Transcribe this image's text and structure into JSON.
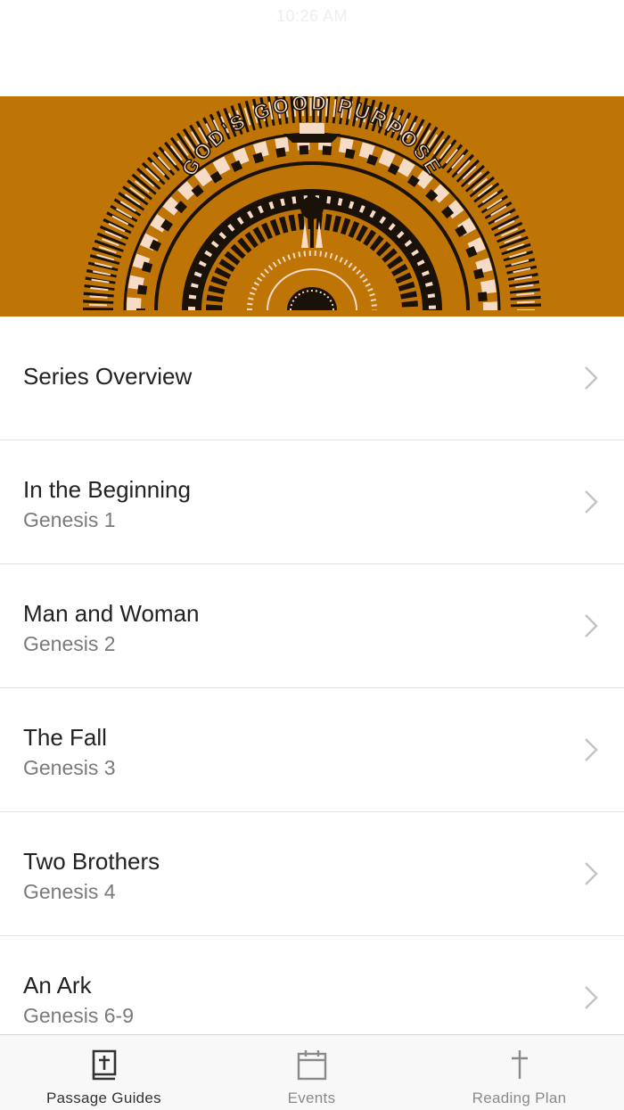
{
  "status_bar": {
    "time": "10:26 AM"
  },
  "banner": {
    "title": "GOD'S GOOD PURPOSE",
    "colors": {
      "background": "#bf7406",
      "dark": "#1a1208",
      "light": "#f6dcc6"
    }
  },
  "list": {
    "items": [
      {
        "title": "Series Overview",
        "subtitle": ""
      },
      {
        "title": "In the Beginning",
        "subtitle": "Genesis 1"
      },
      {
        "title": "Man and Woman",
        "subtitle": "Genesis 2"
      },
      {
        "title": "The Fall",
        "subtitle": "Genesis 3"
      },
      {
        "title": "Two Brothers",
        "subtitle": "Genesis 4"
      },
      {
        "title": "An Ark",
        "subtitle": "Genesis 6-9"
      }
    ]
  },
  "tabbar": {
    "tabs": [
      {
        "label": "Passage Guides",
        "icon": "bible-cross-icon",
        "active": true
      },
      {
        "label": "Events",
        "icon": "calendar-icon",
        "active": false
      },
      {
        "label": "Reading Plan",
        "icon": "cross-icon",
        "active": false
      }
    ]
  }
}
